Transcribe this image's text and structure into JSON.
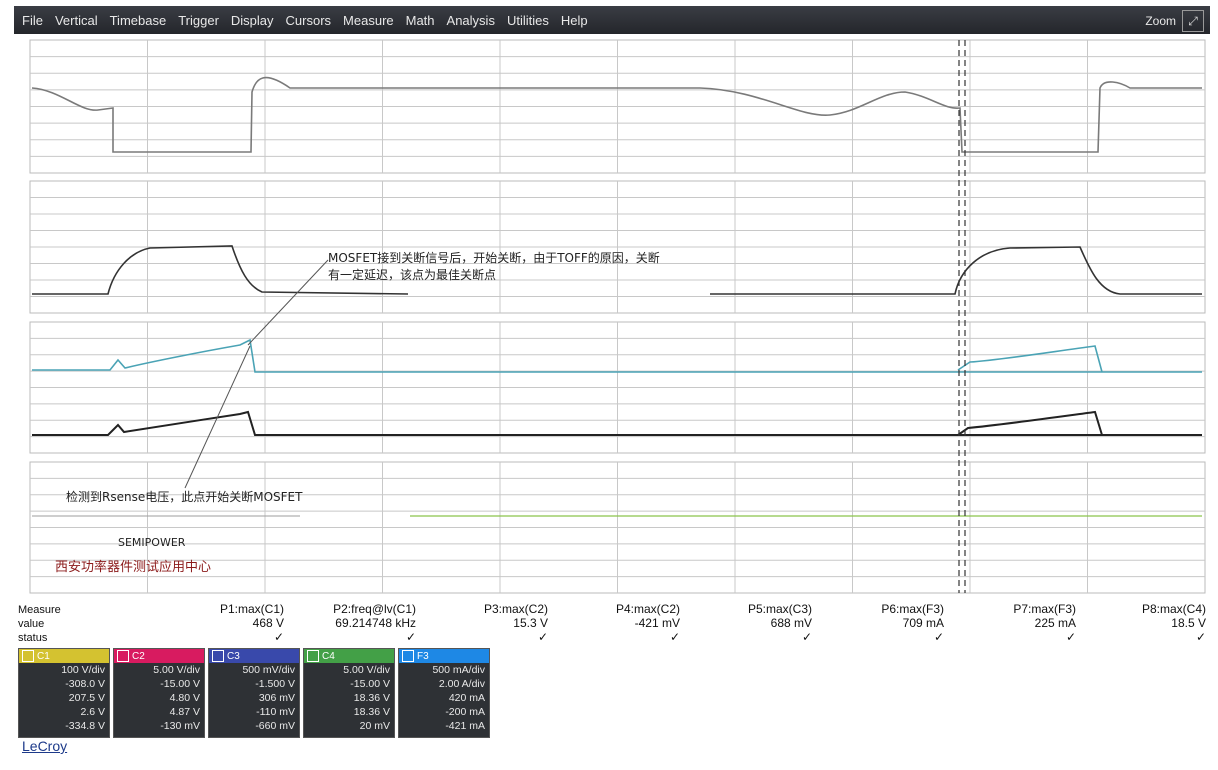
{
  "menu": [
    "File",
    "Vertical",
    "Timebase",
    "Trigger",
    "Display",
    "Cursors",
    "Measure",
    "Math",
    "Analysis",
    "Utilities",
    "Help"
  ],
  "zoom_label": "Zoom",
  "zoom_icon": "zoom-icon",
  "colors": {
    "grid": "#c8c8c8",
    "trace_c1": "#7a7a7a",
    "trace_c2": "#333333",
    "trace_c3": "#4aa3b5",
    "trace_c4": "#222222",
    "trace_c5": "#8bc34a",
    "cursor": "#333333",
    "annotation_line": "#555555"
  },
  "annotations": {
    "top_line1": "MOSFET接到关断信号后，开始关断，由于TOFF的原因，关断",
    "top_line2": "有一定延迟，该点为最佳关断点",
    "bottom_line": "检测到Rsense电压，此点开始关断MOSFET",
    "source_line1": "SEMIPOWER",
    "source_line2": "西安功率器件测试应用中心"
  },
  "measurements": {
    "row_labels": [
      "Measure",
      "value",
      "status"
    ],
    "columns": [
      {
        "name": "P1:max(C1)",
        "value": "468 V",
        "status": "✓"
      },
      {
        "name": "P2:freq@lv(C1)",
        "value": "69.214748 kHz",
        "status": "✓"
      },
      {
        "name": "P3:max(C2)",
        "value": "15.3 V",
        "status": "✓"
      },
      {
        "name": "P4:max(C2)",
        "value": "-421 mV",
        "status": "✓"
      },
      {
        "name": "P5:max(C3)",
        "value": "688 mV",
        "status": "✓"
      },
      {
        "name": "P6:max(F3)",
        "value": "709 mA",
        "status": "✓"
      },
      {
        "name": "P7:max(F3)",
        "value": "225 mA",
        "status": "✓"
      },
      {
        "name": "P8:max(C4)",
        "value": "18.5 V",
        "status": "✓"
      }
    ]
  },
  "channel_panels": [
    {
      "color": "#d4c230",
      "label": "C1",
      "rows": [
        "100 V/div",
        "-308.0 V",
        "207.5 V",
        "2.6 V",
        "-334.8 V"
      ]
    },
    {
      "color": "#d81b60",
      "label": "C2",
      "rows": [
        "5.00 V/div",
        "-15.00 V",
        "4.80 V",
        "4.87 V",
        "-130 mV"
      ]
    },
    {
      "color": "#3949ab",
      "label": "C3",
      "rows": [
        "500 mV/div",
        "-1.500 V",
        "306 mV",
        "-110 mV",
        "-660 mV"
      ]
    },
    {
      "color": "#43a047",
      "label": "C4",
      "rows": [
        "5.00 V/div",
        "-15.00 V",
        "18.36 V",
        "18.36 V",
        "20 mV"
      ]
    },
    {
      "color": "#1e88e5",
      "label": "F3",
      "rows": [
        "500 mA/div",
        "2.00 A/div",
        "420 mA",
        "-200 mA",
        "-421 mA"
      ]
    }
  ],
  "brand": "LeCroy"
}
